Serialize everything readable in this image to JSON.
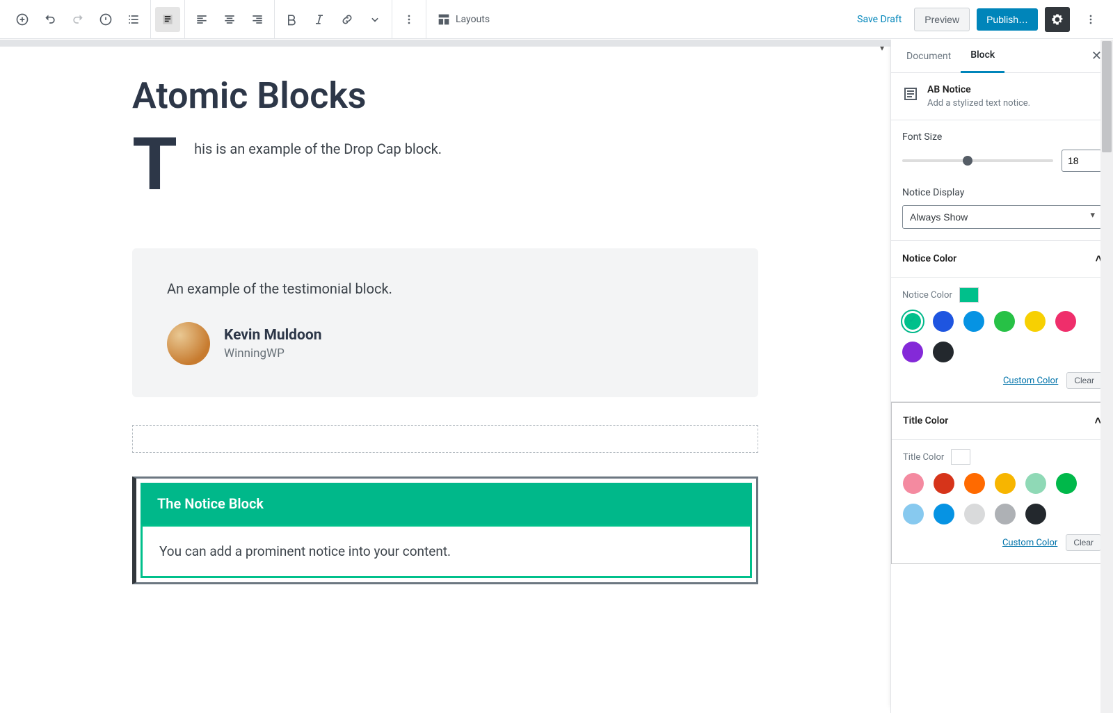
{
  "toolbar": {
    "layouts_label": "Layouts",
    "save_draft": "Save Draft",
    "preview": "Preview",
    "publish": "Publish…"
  },
  "post": {
    "title": "Atomic Blocks",
    "dropcap_letter": "T",
    "dropcap_text": "his is an example of the Drop Cap block.",
    "testimonial": {
      "text": "An example of the testimonial block.",
      "author": "Kevin Muldoon",
      "sub": "WinningWP"
    },
    "notice": {
      "title": "The Notice Block",
      "body": "You can add a prominent notice into your content."
    }
  },
  "sidebar": {
    "tabs": {
      "document": "Document",
      "block": "Block"
    },
    "block_info": {
      "title": "AB Notice",
      "desc": "Add a stylized text notice."
    },
    "font_size": {
      "label": "Font Size",
      "value": "18"
    },
    "notice_display": {
      "label": "Notice Display",
      "value": "Always Show"
    },
    "notice_color": {
      "heading": "Notice Color",
      "label": "Notice Color",
      "current": "#00c08b",
      "swatches": [
        "#00c08b",
        "#1e55e0",
        "#0693e3",
        "#27c146",
        "#f7d002",
        "#ef2e6b",
        "#8429d8",
        "#23282d"
      ],
      "custom": "Custom Color",
      "clear": "Clear"
    },
    "title_color": {
      "heading": "Title Color",
      "label": "Title Color",
      "current": "#ffffff",
      "swatches": [
        "#f48aa0",
        "#d6341a",
        "#ff6a00",
        "#f7b500",
        "#8fd9b6",
        "#00b84a",
        "#87c9ef",
        "#0693e3",
        "#d9dadb",
        "#aeb1b5",
        "#23282d"
      ],
      "custom": "Custom Color",
      "clear": "Clear"
    }
  }
}
